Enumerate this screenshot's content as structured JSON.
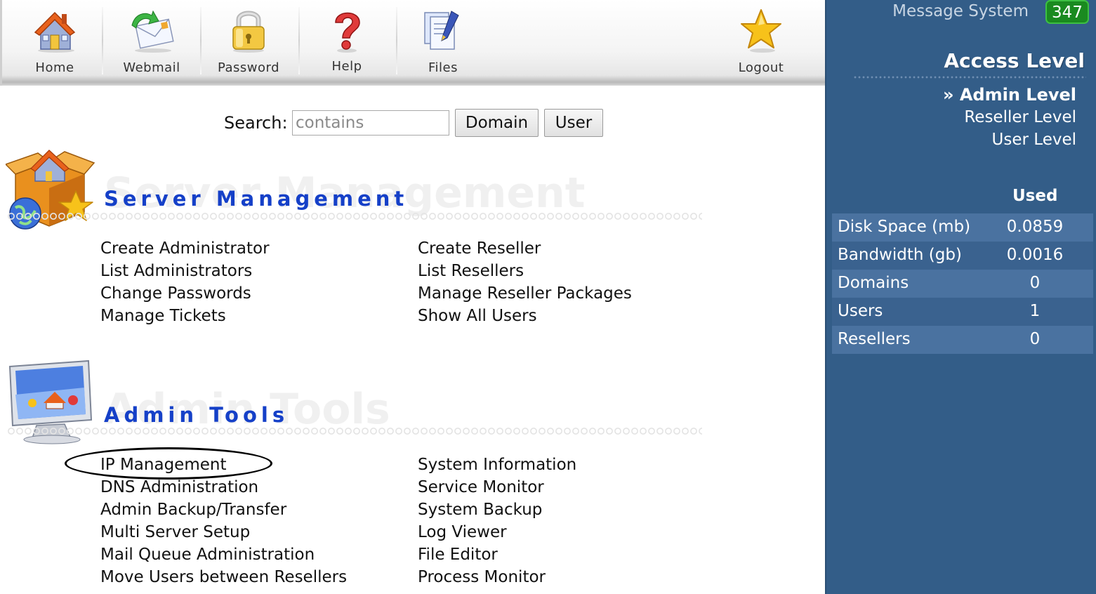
{
  "toolbar": {
    "items": [
      {
        "label": "Home",
        "icon": "home-icon"
      },
      {
        "label": "Webmail",
        "icon": "webmail-icon"
      },
      {
        "label": "Password",
        "icon": "lock-icon"
      },
      {
        "label": "Help",
        "icon": "question-mark-icon"
      },
      {
        "label": "Files",
        "icon": "files-icon"
      },
      {
        "label": "Logout",
        "icon": "star-icon"
      }
    ]
  },
  "search": {
    "label": "Search:",
    "placeholder": "contains",
    "domain_button": "Domain",
    "user_button": "User"
  },
  "server_management": {
    "title": "Server Management",
    "left_links": [
      "Create Administrator",
      "List Administrators",
      "Change Passwords",
      "Manage Tickets"
    ],
    "right_links": [
      "Create Reseller",
      "List Resellers",
      "Manage Reseller Packages",
      "Show All Users"
    ]
  },
  "admin_tools": {
    "title": "Admin Tools",
    "left_links": [
      "IP Management",
      "DNS Administration",
      "Admin Backup/Transfer",
      "Multi Server Setup",
      "Mail Queue Administration",
      "Move Users between Resellers"
    ],
    "right_links": [
      "System Information",
      "Service Monitor",
      "System Backup",
      "Log Viewer",
      "File Editor",
      "Process Monitor"
    ]
  },
  "sidebar": {
    "message_label": "Message System",
    "message_count": "347",
    "access_title": "Access Level",
    "levels": [
      "» Admin Level",
      "Reseller Level",
      "User Level"
    ],
    "used_header": "Used",
    "stats": [
      {
        "name": "Disk Space (mb)",
        "value": "0.0859"
      },
      {
        "name": "Bandwidth (gb)",
        "value": "0.0016"
      },
      {
        "name": "Domains",
        "value": "0"
      },
      {
        "name": "Users",
        "value": "1"
      },
      {
        "name": "Resellers",
        "value": "0"
      }
    ]
  },
  "colors": {
    "sidebar_bg": "#335d88",
    "section_title": "#1540c8",
    "badge_green": "#1a8a20"
  }
}
